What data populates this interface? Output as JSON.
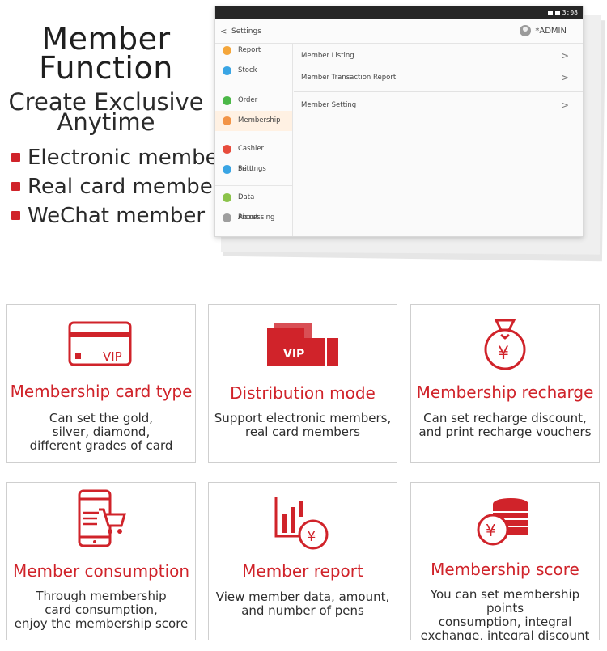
{
  "promo": {
    "title_line1": "Member",
    "title_line2": "Function",
    "subtitle_line1": "Create Exclusive",
    "subtitle_line2": "Anytime",
    "features": [
      "Electronic member",
      "Real card member",
      "WeChat member"
    ]
  },
  "screen": {
    "status_time": "3:08",
    "back_glyph": "<",
    "title": "Settings",
    "user": "*ADMIN",
    "sidebar": [
      {
        "label": "Report",
        "color": "#f4a63b"
      },
      {
        "label": "Stock",
        "color": "#3aa5e4"
      },
      {
        "label": "Order",
        "color": "#4cb848"
      },
      {
        "label": "Membership",
        "color": "#f29447"
      },
      {
        "label": "Cashier Settings",
        "color": "#e74c3c"
      },
      {
        "label": "Print",
        "color": "#3aa5e4"
      },
      {
        "label": "Data Processing",
        "color": "#8bc34a"
      },
      {
        "label": "About",
        "color": "#9e9e9e"
      }
    ],
    "rows": [
      "Member Listing",
      "Member Transaction Report",
      "Member Setting"
    ],
    "chevron": ">"
  },
  "colors": {
    "accent": "#d0232a"
  },
  "cards": [
    {
      "icon": "vip-card-icon",
      "title": "Membership card type",
      "desc": [
        "Can set the gold,",
        "silver, diamond,",
        "different grades of card"
      ],
      "vip": "VIP"
    },
    {
      "icon": "vip-tickets-icon",
      "title": "Distribution mode",
      "desc": [
        "Support electronic members,",
        "real card members"
      ],
      "vip": "VIP"
    },
    {
      "icon": "money-bag-icon",
      "title": "Membership recharge",
      "desc": [
        "Can set recharge discount,",
        "and print recharge vouchers"
      ],
      "yen": "¥"
    },
    {
      "icon": "phone-cart-icon",
      "title": "Member consumption",
      "desc": [
        "Through membership",
        "card consumption,",
        "enjoy the membership score"
      ]
    },
    {
      "icon": "bar-chart-coin-icon",
      "title": "Member report",
      "desc": [
        "View member data, amount,",
        "and number of pens"
      ],
      "yen": "¥"
    },
    {
      "icon": "coin-stack-icon",
      "title": "Membership score",
      "desc": [
        "You can set membership points",
        "consumption, integral",
        "exchange, integral discount"
      ],
      "yen": "¥"
    }
  ]
}
